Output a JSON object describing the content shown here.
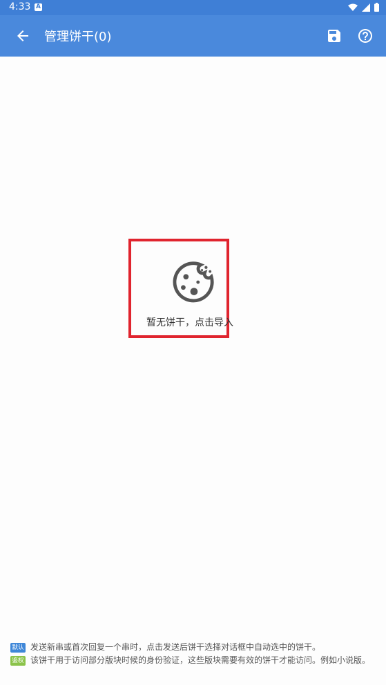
{
  "status_bar": {
    "time": "4:33",
    "notification_icon": "A"
  },
  "app_bar": {
    "title": "管理饼干(0)",
    "back_icon": "arrow-back",
    "save_icon": "floppy-disk",
    "help_icon": "help-circle"
  },
  "empty_state": {
    "message": "暂无饼干，点击导入",
    "icon": "cookie"
  },
  "notes": [
    {
      "tag": "默认",
      "tag_color": "#3f87d8",
      "text": "发送新串或首次回复一个串时，点击发送后饼干选择对话框中自动选中的饼干。"
    },
    {
      "tag": "鉴权",
      "tag_color": "#8bc34a",
      "text": "该饼干用于访问部分版块时候的身份验证，这些版块需要有效的饼干才能访问。例如小说版。"
    }
  ]
}
